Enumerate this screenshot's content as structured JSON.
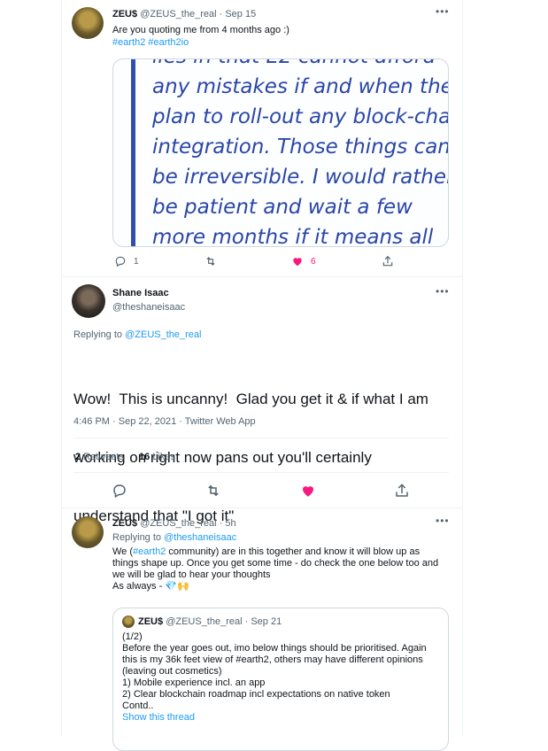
{
  "tweet1": {
    "name": "ZEU$",
    "handle_date": "@ZEUS_the_real · Sep 15",
    "text": "Are you quoting me from 4 months ago :)",
    "hashtags": "#earth2 #earth2io",
    "image_lines": [
      "lies in that E2 cannot afford",
      "any mistakes if and when they",
      "plan to roll-out any block-chain",
      "integration. Those things can",
      "be irreversible. I would rather",
      "be patient and wait a few",
      "more months if it means all"
    ],
    "replies": "1",
    "likes": "6"
  },
  "main_tweet": {
    "name": "Shane Isaac",
    "handle": "@theshaneisaac",
    "replying_prefix": "Replying to ",
    "replying_to": "@ZEUS_the_real",
    "text_lines": [
      "Wow!  This is uncanny!  Glad you get it & if what I am",
      "working on right now pans out you'll certainly",
      "understand that \"I got it\""
    ],
    "meta": "4:46 PM · Sep 22, 2021 · Twitter Web App",
    "retweets_count": "2",
    "retweets_label": "Retweets",
    "likes_count": "16",
    "likes_label": "Likes"
  },
  "reply": {
    "name": "ZEU$",
    "handle_time": "@ZEUS_the_real · 5h",
    "replying_prefix": "Replying to ",
    "replying_to": "@theshaneisaac",
    "line1_a": "We (",
    "line1_tag": "#earth2",
    "line1_b": " community) are in this together and know it will blow up as",
    "line2": "things shape up. Once you get some time - do check the one below too and",
    "line3": "we will be glad to hear your thoughts",
    "line4": "As always - ",
    "emoji": "💎🙌"
  },
  "quoted": {
    "name": "ZEU$",
    "handle_date": "@ZEUS_the_real · Sep 21",
    "lines": [
      "(1/2)",
      "Before the year goes out, imo below things should be prioritised. Again",
      "this is my 36k feet view of #earth2, others may have different opinions",
      "(leaving out cosmetics)",
      "1) Mobile experience incl. an app",
      "2) Clear blockchain roadmap incl expectations on native token",
      "Contd.."
    ],
    "show_thread": "Show this thread"
  },
  "icons": {
    "reply": "reply-icon",
    "retweet": "retweet-icon",
    "like": "heart-icon",
    "share": "share-icon",
    "more": "more-icon"
  },
  "colors": {
    "accent": "#1d9bf0",
    "like": "#f91880",
    "quote_text": "#2a46a8"
  }
}
